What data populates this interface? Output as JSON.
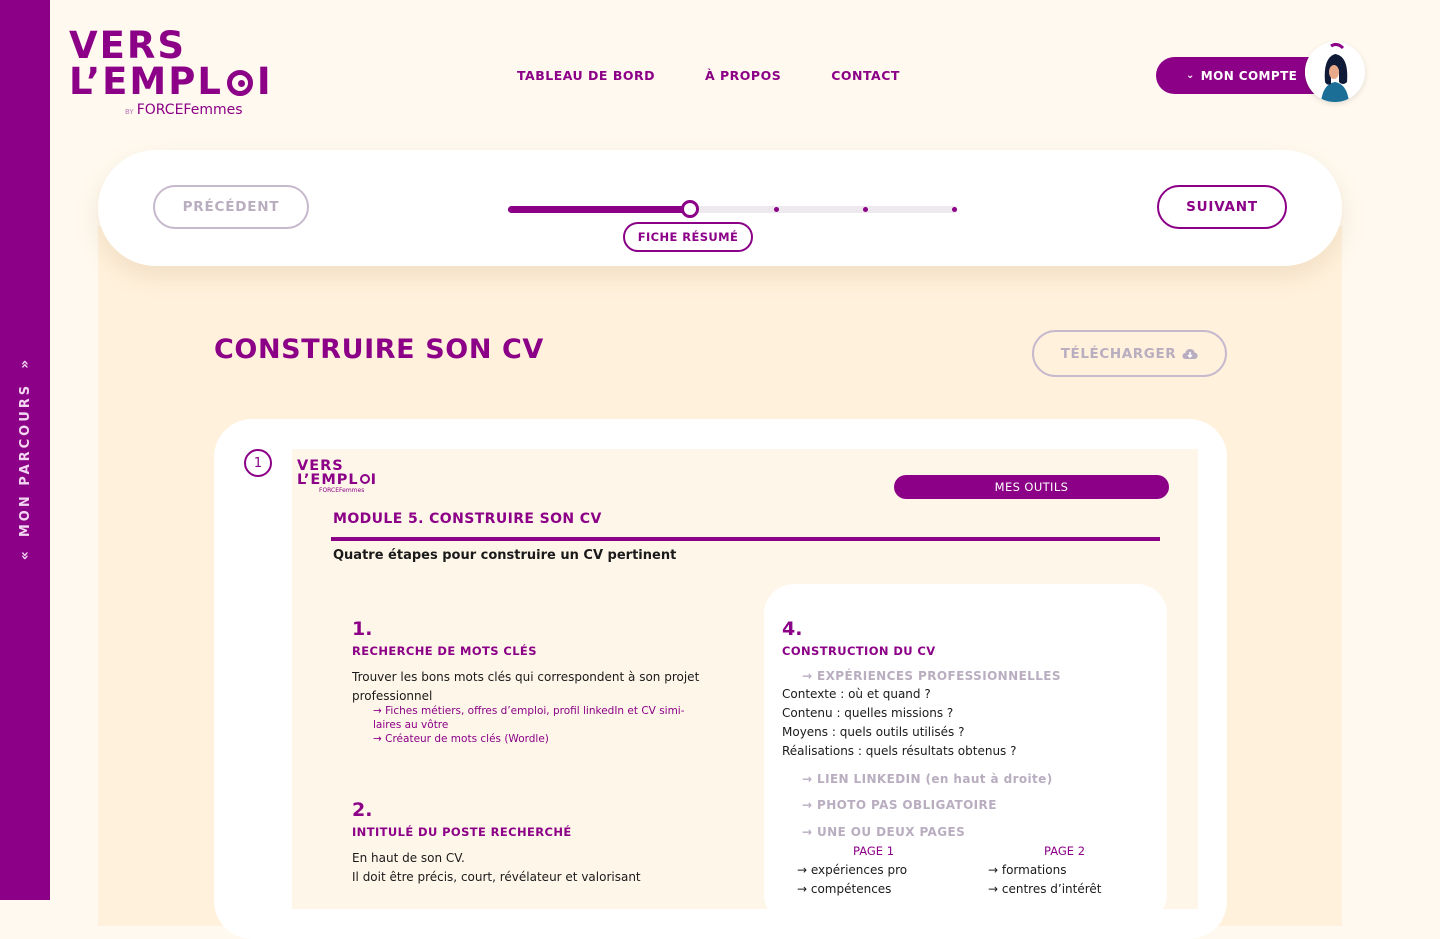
{
  "sidebar": {
    "label": "MON PARCOURS"
  },
  "logo": {
    "line1": "VERS",
    "line2": "L’EMPL",
    "line2_end": "I",
    "by": "BY",
    "brand": "FORCEFemmes"
  },
  "nav": {
    "items": [
      "TABLEAU DE BORD",
      "À PROPOS",
      "CONTACT"
    ]
  },
  "account": {
    "label": "MON COMPTE"
  },
  "progress": {
    "prev_label": "PRÉCÉDENT",
    "next_label": "SUIVANT",
    "current_step_label": "FICHE RÉSUMÉ",
    "current_step": 3,
    "total_steps": 6
  },
  "page": {
    "title": "CONSTRUIRE SON CV",
    "download_label": "TÉLÉCHARGER"
  },
  "document": {
    "index": "1",
    "mini_logo_line1": "VERS",
    "mini_logo_line2": "L’EMPL",
    "mini_logo_line2_end": "I",
    "mini_logo_brand": "FORCEFemmes",
    "tag": "MES OUTILS",
    "module_title": "MODULE 5. CONSTRUIRE SON CV",
    "subtitle": "Quatre étapes pour construire un CV pertinent",
    "step1": {
      "num": "1.",
      "head": "RECHERCHE DE MOTS CLÉS",
      "text_l1": "Trouver les bons mots clés qui correspondent à son projet",
      "text_l2": "professionnel",
      "link1_l1": "→ Fiches métiers, offres d’emploi, profil linkedIn et CV simi-",
      "link1_l2": "laires au vôtre",
      "link2": "→ Créateur de mots clés (Wordle)"
    },
    "step2": {
      "num": "2.",
      "head": "INTITULÉ DU POSTE RECHERCHÉ",
      "text_l1": "En haut de son CV.",
      "text_l2": "Il doit être précis, court, révélateur et valorisant"
    },
    "step4": {
      "num": "4.",
      "head": "CONSTRUCTION DU CV",
      "sub1": "→ EXPÉRIENCES PROFESSIONNELLES",
      "lines": [
        "Contexte : où et quand ?",
        "Contenu : quelles missions ?",
        "Moyens : quels outils utilisés ?",
        "Réalisations : quels résultats obtenus ?"
      ],
      "sub2": "→ LIEN LINKEDIN (en haut à droite)",
      "sub3": "→ PHOTO PAS OBLIGATOIRE",
      "sub4": "→ UNE OU DEUX PAGES",
      "page1_head": "PAGE 1",
      "page1_items": [
        "→ expériences pro",
        "→ compétences"
      ],
      "page2_head": "PAGE 2",
      "page2_items": [
        "→ formations",
        "→ centres d’intérêt"
      ]
    }
  },
  "colors": {
    "brand": "#8b0086",
    "background": "#fff9ef",
    "panel": "#fff1dc",
    "muted": "#b9adc0"
  }
}
